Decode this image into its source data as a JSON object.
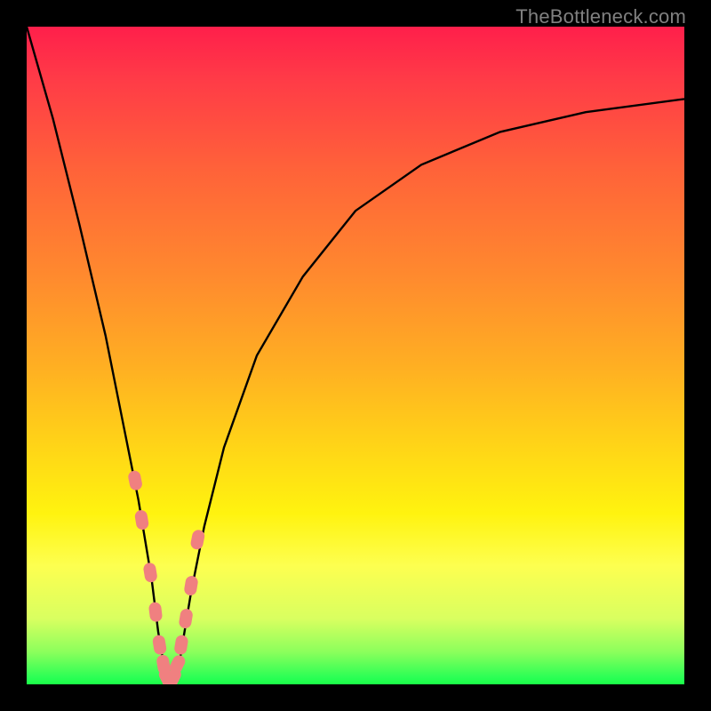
{
  "watermark": "TheBottleneck.com",
  "chart_data": {
    "type": "line",
    "title": "",
    "xlabel": "",
    "ylabel": "",
    "xlim": [
      0,
      100
    ],
    "ylim": [
      0,
      100
    ],
    "background_gradient": {
      "top_color": "#ff1f4b",
      "mid_color": "#ffd517",
      "bottom_color": "#1aff47",
      "meaning": "red=high bottleneck, green=low bottleneck"
    },
    "series": [
      {
        "name": "bottleneck-curve",
        "color": "#000000",
        "x": [
          0,
          4,
          8,
          12,
          15,
          17,
          19,
          20,
          21,
          22,
          23,
          24,
          25,
          27,
          30,
          35,
          42,
          50,
          60,
          72,
          85,
          100
        ],
        "y": [
          100,
          86,
          70,
          53,
          38,
          28,
          16,
          8,
          2,
          0,
          2,
          8,
          14,
          24,
          36,
          50,
          62,
          72,
          79,
          84,
          87,
          89
        ]
      }
    ],
    "markers": {
      "name": "highlighted-points",
      "color": "#f08080",
      "shape": "capsule",
      "x": [
        16.5,
        17.5,
        18.8,
        19.6,
        20.2,
        20.8,
        21.3,
        21.8,
        22.3,
        22.9,
        23.5,
        24.2,
        25.0,
        26.0
      ],
      "y": [
        31,
        25,
        17,
        11,
        6,
        3,
        1,
        0,
        1,
        3,
        6,
        10,
        15,
        22
      ]
    }
  }
}
